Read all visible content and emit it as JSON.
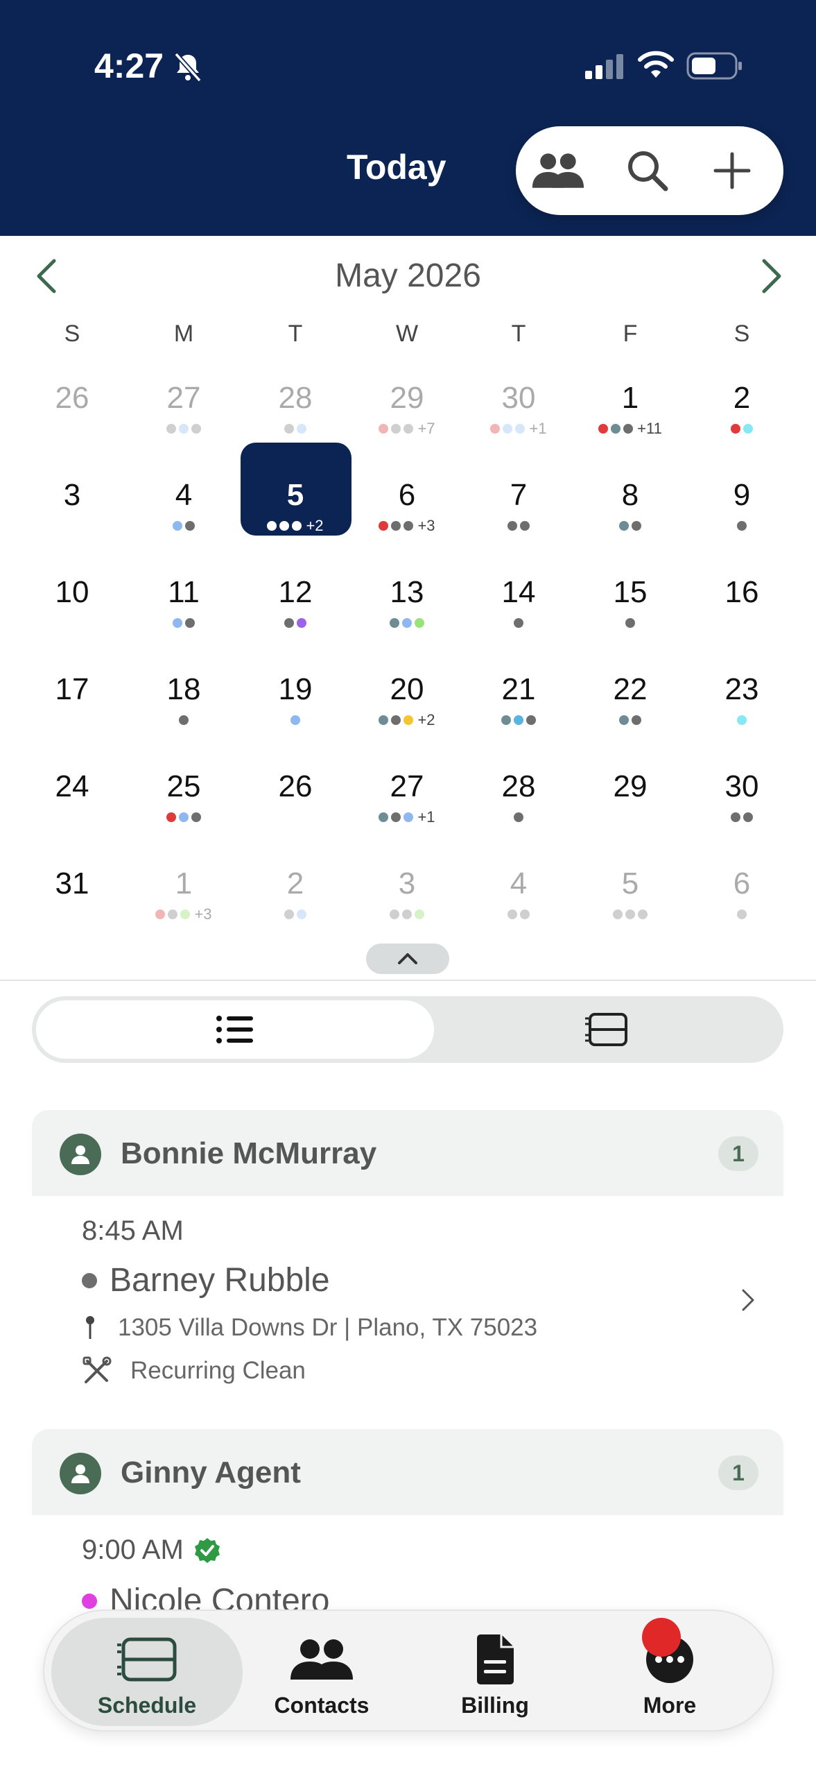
{
  "status_bar": {
    "time": "4:27"
  },
  "header": {
    "today_label": "Today",
    "actions": [
      "people-icon",
      "search-icon",
      "plus-icon"
    ]
  },
  "calendar": {
    "month_title": "May 2026",
    "weekdays": [
      "S",
      "M",
      "T",
      "W",
      "T",
      "F",
      "S"
    ],
    "selected_day": "5",
    "colors": {
      "red": "#e03a3a",
      "grey": "#6e6e6e",
      "blue": "#8fb8f0",
      "teal": "#6d8d94",
      "purple": "#9a63e8",
      "green": "#9be27a",
      "yellow": "#f2c531",
      "cyan": "#86e8f2",
      "white": "#ffffff"
    },
    "weeks": [
      [
        {
          "d": "26",
          "other": true,
          "dots": [],
          "more": ""
        },
        {
          "d": "27",
          "other": true,
          "dots": [
            "#cfcfcf",
            "#d7e6f8",
            "#cfcfcf"
          ],
          "more": ""
        },
        {
          "d": "28",
          "other": true,
          "dots": [
            "#cfcfcf",
            "#d7e6f8"
          ],
          "more": ""
        },
        {
          "d": "29",
          "other": true,
          "dots": [
            "#f1b5b5",
            "#cfcfcf",
            "#cfcfcf"
          ],
          "more": "+7"
        },
        {
          "d": "30",
          "other": true,
          "dots": [
            "#f1b5b5",
            "#d7e6f8",
            "#d7e6f8"
          ],
          "more": "+1"
        },
        {
          "d": "1",
          "other": false,
          "dots": [
            "#e03a3a",
            "#6d8d94",
            "#6e6e6e"
          ],
          "more": "+11"
        },
        {
          "d": "2",
          "other": false,
          "dots": [
            "#e03a3a",
            "#86e8f2"
          ],
          "more": ""
        }
      ],
      [
        {
          "d": "3",
          "other": false,
          "dots": [],
          "more": ""
        },
        {
          "d": "4",
          "other": false,
          "dots": [
            "#8fb8f0",
            "#6e6e6e"
          ],
          "more": ""
        },
        {
          "d": "5",
          "other": false,
          "dots": [
            "#ffffff",
            "#ffffff",
            "#ffffff"
          ],
          "more": "+2",
          "selected": true
        },
        {
          "d": "6",
          "other": false,
          "dots": [
            "#e03a3a",
            "#6e6e6e",
            "#6e6e6e"
          ],
          "more": "+3"
        },
        {
          "d": "7",
          "other": false,
          "dots": [
            "#6e6e6e",
            "#6e6e6e"
          ],
          "more": ""
        },
        {
          "d": "8",
          "other": false,
          "dots": [
            "#6d8d94",
            "#6e6e6e"
          ],
          "more": ""
        },
        {
          "d": "9",
          "other": false,
          "dots": [
            "#6e6e6e"
          ],
          "more": ""
        }
      ],
      [
        {
          "d": "10",
          "other": false,
          "dots": [],
          "more": ""
        },
        {
          "d": "11",
          "other": false,
          "dots": [
            "#8fb8f0",
            "#6e6e6e"
          ],
          "more": ""
        },
        {
          "d": "12",
          "other": false,
          "dots": [
            "#6e6e6e",
            "#9a63e8"
          ],
          "more": ""
        },
        {
          "d": "13",
          "other": false,
          "dots": [
            "#6d8d94",
            "#8fb8f0",
            "#9be27a"
          ],
          "more": ""
        },
        {
          "d": "14",
          "other": false,
          "dots": [
            "#6e6e6e"
          ],
          "more": ""
        },
        {
          "d": "15",
          "other": false,
          "dots": [
            "#6e6e6e"
          ],
          "more": ""
        },
        {
          "d": "16",
          "other": false,
          "dots": [],
          "more": ""
        }
      ],
      [
        {
          "d": "17",
          "other": false,
          "dots": [],
          "more": ""
        },
        {
          "d": "18",
          "other": false,
          "dots": [
            "#6e6e6e"
          ],
          "more": ""
        },
        {
          "d": "19",
          "other": false,
          "dots": [
            "#8fb8f0"
          ],
          "more": ""
        },
        {
          "d": "20",
          "other": false,
          "dots": [
            "#6d8d94",
            "#6e6e6e",
            "#f2c531"
          ],
          "more": "+2"
        },
        {
          "d": "21",
          "other": false,
          "dots": [
            "#6d8d94",
            "#5ab4e0",
            "#6e6e6e"
          ],
          "more": ""
        },
        {
          "d": "22",
          "other": false,
          "dots": [
            "#6d8d94",
            "#6e6e6e"
          ],
          "more": ""
        },
        {
          "d": "23",
          "other": false,
          "dots": [
            "#86e8f2"
          ],
          "more": ""
        }
      ],
      [
        {
          "d": "24",
          "other": false,
          "dots": [],
          "more": ""
        },
        {
          "d": "25",
          "other": false,
          "dots": [
            "#e03a3a",
            "#8fb8f0",
            "#6e6e6e"
          ],
          "more": ""
        },
        {
          "d": "26",
          "other": false,
          "dots": [],
          "more": ""
        },
        {
          "d": "27",
          "other": false,
          "dots": [
            "#6d8d94",
            "#6e6e6e",
            "#8fb8f0"
          ],
          "more": "+1"
        },
        {
          "d": "28",
          "other": false,
          "dots": [
            "#6e6e6e"
          ],
          "more": ""
        },
        {
          "d": "29",
          "other": false,
          "dots": [],
          "more": ""
        },
        {
          "d": "30",
          "other": false,
          "dots": [
            "#6e6e6e",
            "#6e6e6e"
          ],
          "more": ""
        }
      ],
      [
        {
          "d": "31",
          "other": false,
          "dots": [],
          "more": ""
        },
        {
          "d": "1",
          "other": true,
          "dots": [
            "#f1b5b5",
            "#cfcfcf",
            "#d5f3c7"
          ],
          "more": "+3"
        },
        {
          "d": "2",
          "other": true,
          "dots": [
            "#cfcfcf",
            "#d7e6f8"
          ],
          "more": ""
        },
        {
          "d": "3",
          "other": true,
          "dots": [
            "#cfcfcf",
            "#cfcfcf",
            "#d5f3c7"
          ],
          "more": ""
        },
        {
          "d": "4",
          "other": true,
          "dots": [
            "#cfcfcf",
            "#cfcfcf"
          ],
          "more": ""
        },
        {
          "d": "5",
          "other": true,
          "dots": [
            "#cfcfcf",
            "#cfcfcf",
            "#cfcfcf"
          ],
          "more": ""
        },
        {
          "d": "6",
          "other": true,
          "dots": [
            "#cfcfcf"
          ],
          "more": ""
        }
      ]
    ]
  },
  "view_toggle": {
    "selected": "list",
    "options": [
      "list-icon",
      "schedule-icon"
    ]
  },
  "agenda": {
    "groups": [
      {
        "name": "Bonnie McMurray",
        "count": "1",
        "event": {
          "time": "8:45 AM",
          "client": "Barney Rubble",
          "client_dot_color": "#6e6e6e",
          "address": "1305 Villa Downs Dr | Plano, TX 75023",
          "service": "Recurring Clean"
        }
      },
      {
        "name": "Ginny Agent",
        "count": "1",
        "event": {
          "time": "9:00 AM",
          "client": "Nicole Contero",
          "client_dot_color": "#e040e0",
          "verified": true
        }
      }
    ]
  },
  "bottom_nav": {
    "items": [
      {
        "label": "Schedule",
        "icon": "schedule-icon",
        "active": true
      },
      {
        "label": "Contacts",
        "icon": "contacts-icon",
        "active": false
      },
      {
        "label": "Billing",
        "icon": "document-icon",
        "active": false
      },
      {
        "label": "More",
        "icon": "more-icon",
        "active": false
      }
    ],
    "badge_color": "#e02828"
  }
}
